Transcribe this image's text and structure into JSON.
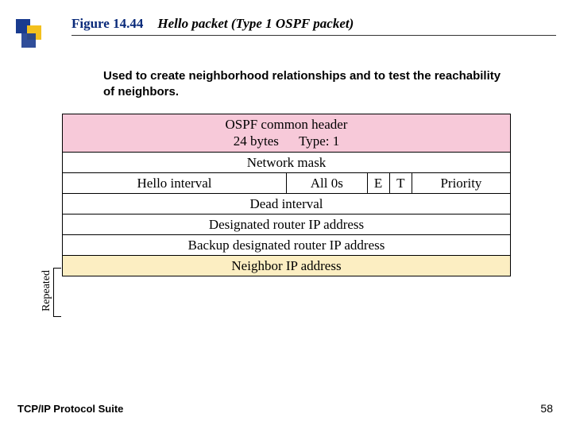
{
  "figure_label": "Figure 14.44",
  "figure_title": "Hello packet (Type 1 OSPF packet)",
  "description": "Used to create neighborhood relationships and to test the reachability of neighbors.",
  "header": {
    "line1": "OSPF common header",
    "line2_left": "24 bytes",
    "line2_right": "Type: 1"
  },
  "rows": {
    "network_mask": "Network mask",
    "hello_interval": "Hello  interval",
    "all0s": "All 0s",
    "e": "E",
    "t": "T",
    "priority": "Priority",
    "dead_interval": "Dead interval",
    "designated": "Designated router IP address",
    "backup": "Backup designated router IP address",
    "neighbor": "Neighbor IP address"
  },
  "repeated_label": "Repeated",
  "footer_left": "TCP/IP Protocol Suite",
  "footer_right": "58",
  "colors": {
    "deco_blue": "#193b8f",
    "deco_yellow": "#f3c01e",
    "pink": "#f7c9d9",
    "yellow_row": "#fceec2"
  }
}
